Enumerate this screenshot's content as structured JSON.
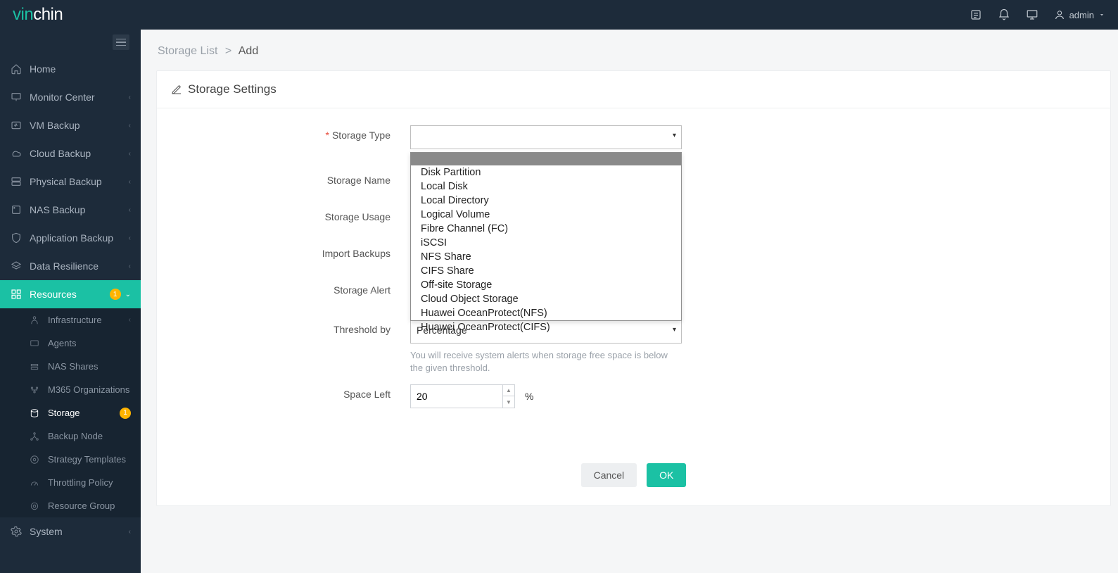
{
  "brand": {
    "vin": "vin",
    "chin": "chin"
  },
  "user": {
    "name": "admin"
  },
  "breadcrumb": {
    "parent": "Storage List",
    "sep": ">",
    "current": "Add"
  },
  "panel": {
    "title": "Storage Settings"
  },
  "form": {
    "storage_type": {
      "label": "Storage Type",
      "required": "*",
      "value": ""
    },
    "storage_name": {
      "label": "Storage Name"
    },
    "storage_usage": {
      "label": "Storage Usage"
    },
    "import_backups": {
      "label": "Import Backups"
    },
    "storage_alert": {
      "label": "Storage Alert"
    },
    "threshold": {
      "label": "Threshold by",
      "selected": "Percentage",
      "hint": "You will receive system alerts when storage free space is below the given threshold."
    },
    "space_left": {
      "label": "Space Left",
      "value": "20",
      "unit": "%"
    }
  },
  "storage_type_options": [
    "Disk Partition",
    "Local Disk",
    "Local Directory",
    "Logical Volume",
    "Fibre Channel (FC)",
    "iSCSI",
    "NFS Share",
    "CIFS Share",
    "Off-site Storage",
    "Cloud Object Storage",
    "Huawei OceanProtect(NFS)",
    "Huawei OceanProtect(CIFS)"
  ],
  "actions": {
    "cancel": "Cancel",
    "ok": "OK"
  },
  "sidebar": {
    "items": [
      {
        "label": "Home"
      },
      {
        "label": "Monitor Center",
        "expandable": true
      },
      {
        "label": "VM Backup",
        "expandable": true
      },
      {
        "label": "Cloud Backup",
        "expandable": true
      },
      {
        "label": "Physical Backup",
        "expandable": true
      },
      {
        "label": "NAS Backup",
        "expandable": true
      },
      {
        "label": "Application Backup",
        "expandable": true
      },
      {
        "label": "Data Resilience",
        "expandable": true
      },
      {
        "label": "Resources",
        "badge": "1",
        "active": true,
        "expandable": true
      }
    ],
    "resources_sub": [
      {
        "label": "Infrastructure",
        "expandable": true
      },
      {
        "label": "Agents"
      },
      {
        "label": "NAS Shares"
      },
      {
        "label": "M365 Organizations"
      },
      {
        "label": "Storage",
        "selected": true,
        "badge": "1"
      },
      {
        "label": "Backup Node"
      },
      {
        "label": "Strategy Templates"
      },
      {
        "label": "Throttling Policy"
      },
      {
        "label": "Resource Group"
      }
    ],
    "after": [
      {
        "label": "System",
        "expandable": true
      }
    ]
  }
}
